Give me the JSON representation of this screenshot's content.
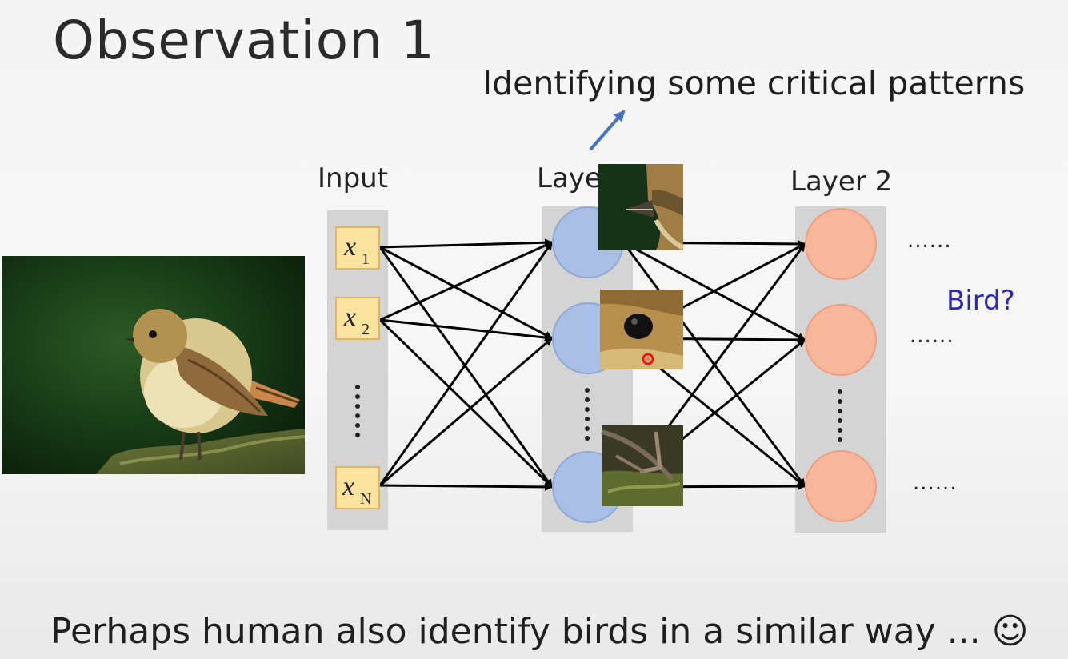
{
  "title": "Observation 1",
  "subtitle": "Identifying some critical patterns",
  "footer": "Perhaps human also identify birds in a similar way ... ☺",
  "input_label": "Input",
  "layer1_label": "Layer 1",
  "layer1_label_visible": "Laye",
  "layer2_label": "Layer 2",
  "inputs": [
    "x",
    "x",
    "x"
  ],
  "input_subscripts": [
    "1",
    "2",
    "N"
  ],
  "ellipsis_h": "......",
  "bird_question": "Bird?",
  "colors": {
    "input_box": "#fde3a0",
    "input_border": "#e0b760",
    "layer1_node": "#a9bfe6",
    "layer2_node": "#f8b79a",
    "column_bg": "#d2d2d2",
    "arrow": "#000000",
    "pointer_arrow": "#4472c4",
    "question_text": "#2a2ab5"
  }
}
